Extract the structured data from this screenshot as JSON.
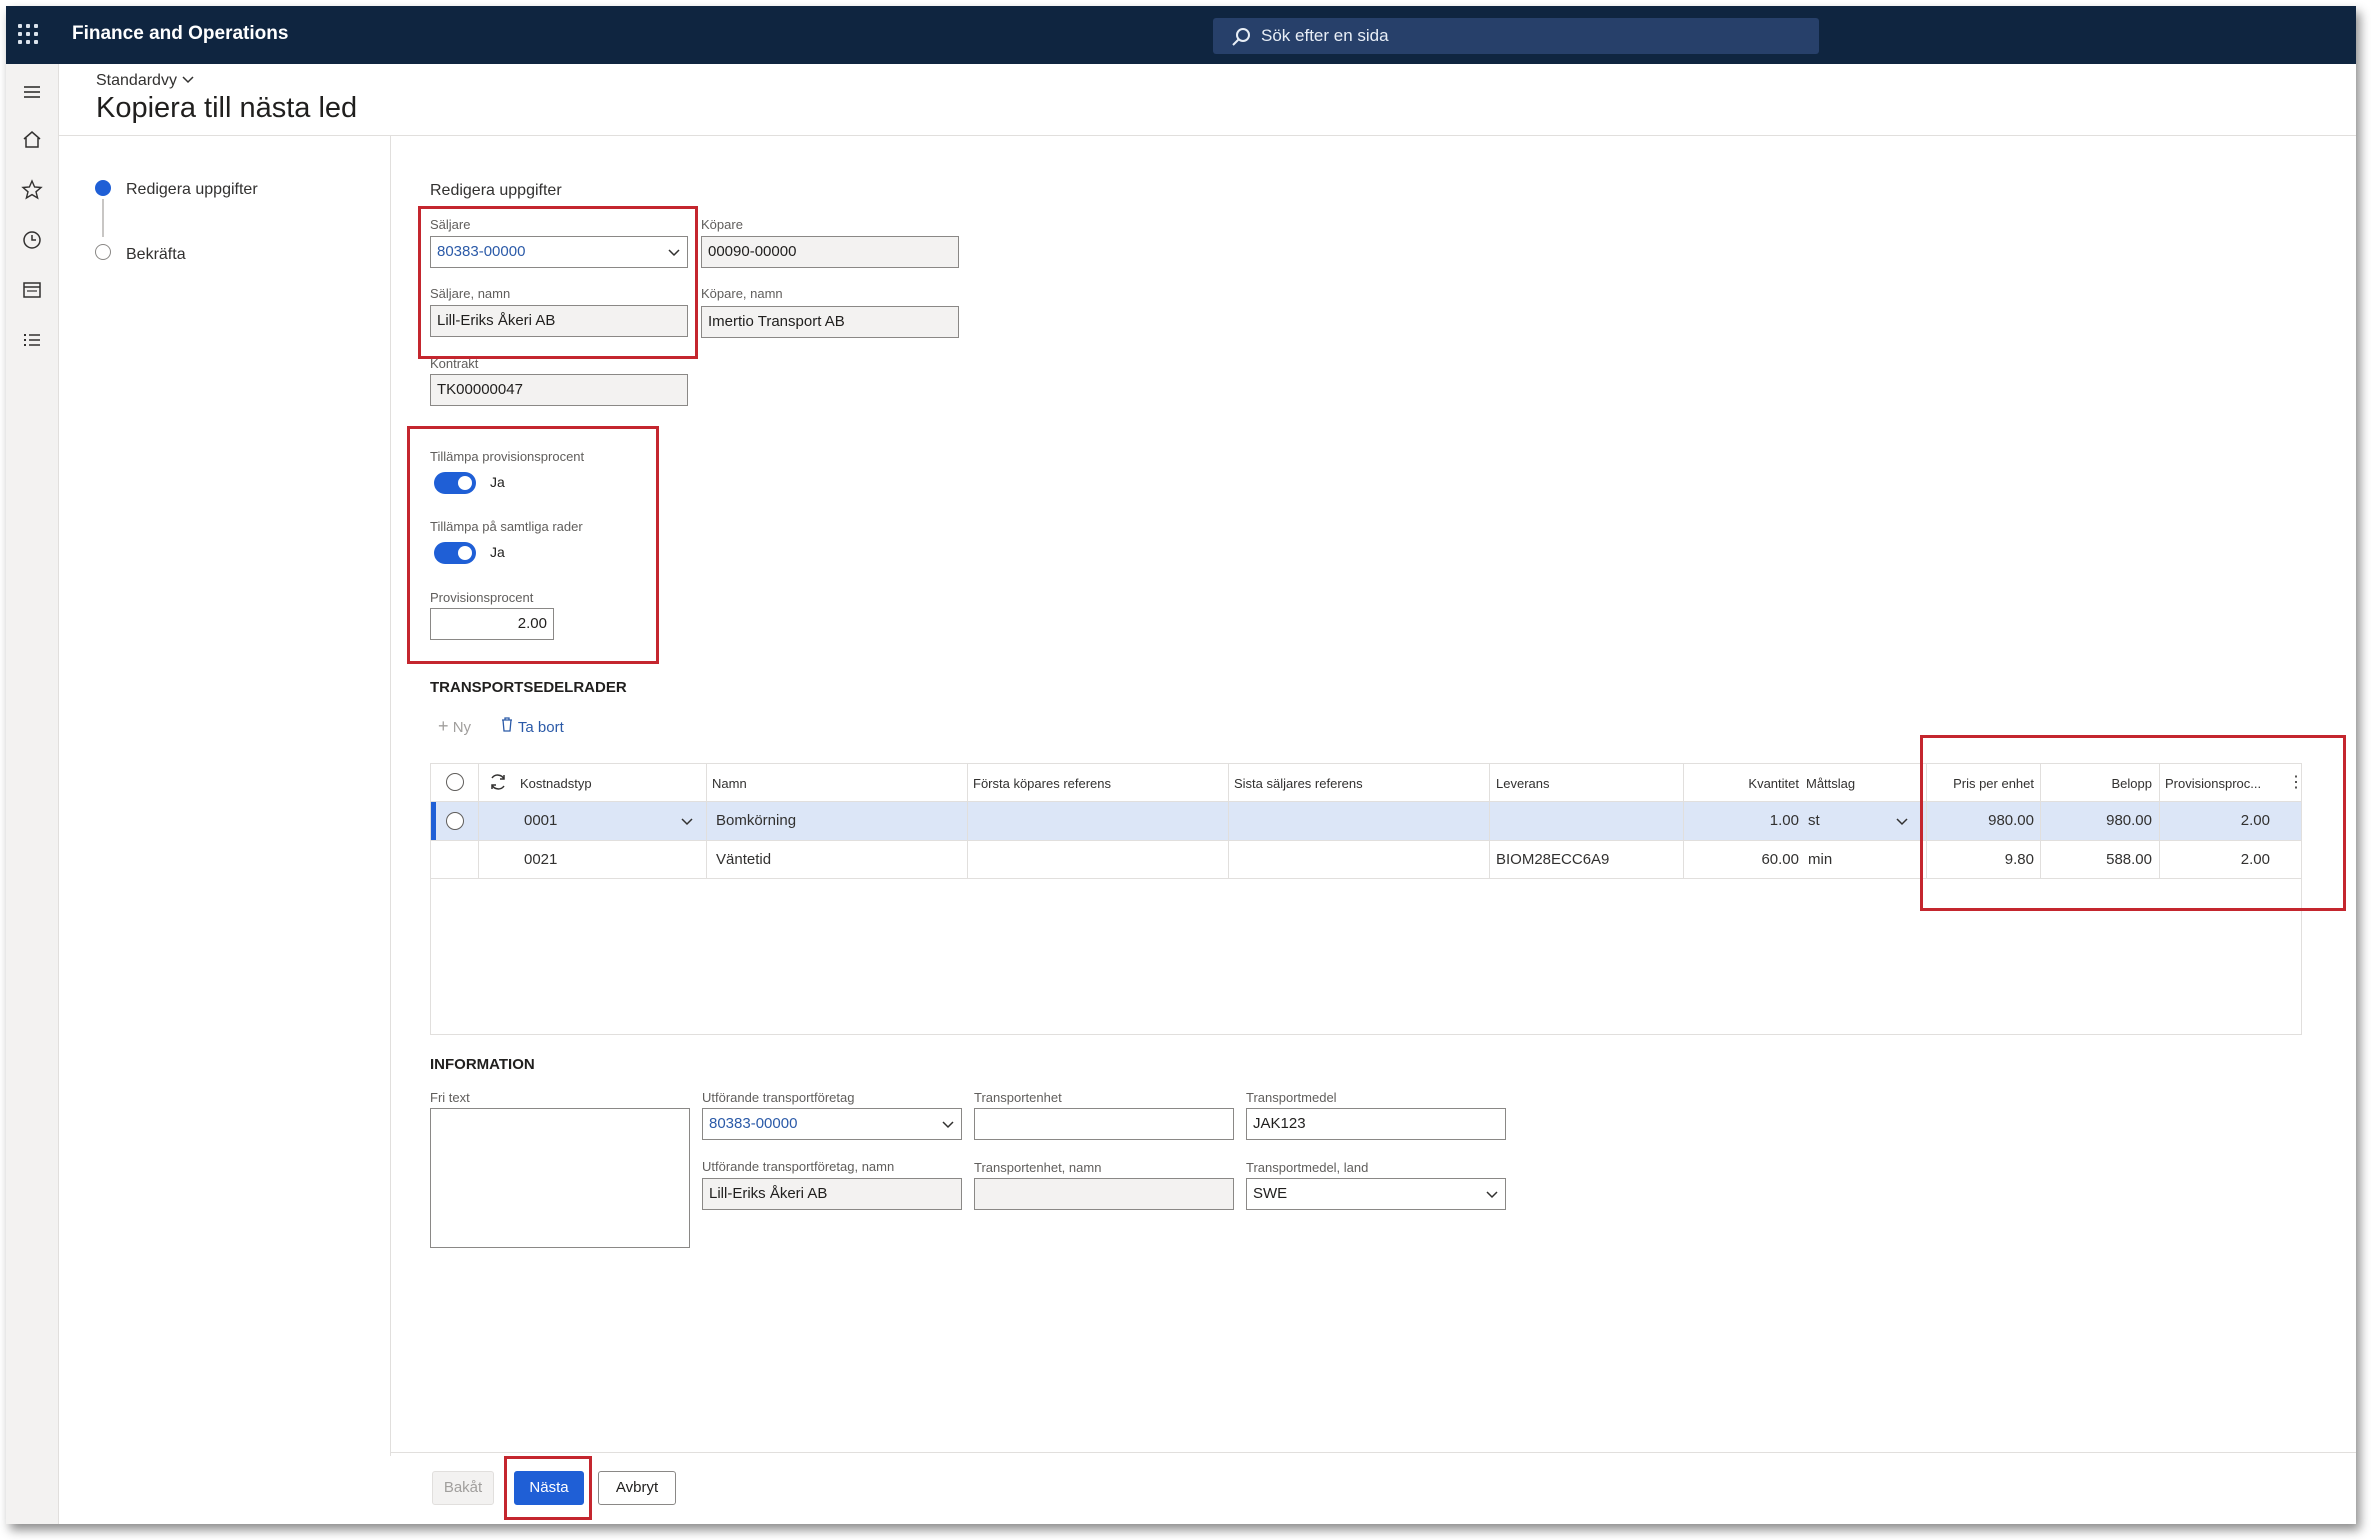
{
  "app": {
    "title": "Finance and Operations"
  },
  "search": {
    "placeholder": "Sök efter en sida"
  },
  "header": {
    "view": "Standardvy",
    "title": "Kopiera till nästa led"
  },
  "steps": [
    {
      "label": "Redigera uppgifter",
      "active": true
    },
    {
      "label": "Bekräfta",
      "active": false
    }
  ],
  "form": {
    "section_title": "Redigera uppgifter",
    "seller_label": "Säljare",
    "seller_value": "80383-00000",
    "seller_name_label": "Säljare, namn",
    "seller_name_value": "Lill-Eriks Åkeri AB",
    "buyer_label": "Köpare",
    "buyer_value": "00090-00000",
    "buyer_name_label": "Köpare, namn",
    "buyer_name_value": "Imertio Transport AB",
    "contract_label": "Kontrakt",
    "contract_value": "TK00000047",
    "apply_commission_label": "Tillämpa provisionsprocent",
    "apply_commission_value": "Ja",
    "apply_all_rows_label": "Tillämpa på samtliga rader",
    "apply_all_rows_value": "Ja",
    "commission_label": "Provisionsprocent",
    "commission_value": "2.00"
  },
  "lines": {
    "title": "TRANSPORTSEDELRADER",
    "new_label": "Ny",
    "delete_label": "Ta bort",
    "columns": [
      "Kostnadstyp",
      "Namn",
      "Första köpares referens",
      "Sista säljares referens",
      "Leverans",
      "Kvantitet",
      "Måttslag",
      "Pris per enhet",
      "Belopp",
      "Provisionsproc..."
    ],
    "rows": [
      {
        "cost_type": "0001",
        "name": "Bomkörning",
        "first_ref": "",
        "last_ref": "",
        "delivery": "",
        "qty": "1.00",
        "unit": "st",
        "price": "980.00",
        "amount": "980.00",
        "commission": "2.00"
      },
      {
        "cost_type": "0021",
        "name": "Väntetid",
        "first_ref": "",
        "last_ref": "",
        "delivery": "BIOM28ECC6A9",
        "qty": "60.00",
        "unit": "min",
        "price": "9.80",
        "amount": "588.00",
        "commission": "2.00"
      }
    ]
  },
  "info": {
    "title": "INFORMATION",
    "free_text_label": "Fri text",
    "carrier_label": "Utförande transportföretag",
    "carrier_value": "80383-00000",
    "carrier_name_label": "Utförande transportföretag, namn",
    "carrier_name_value": "Lill-Eriks Åkeri AB",
    "unit_label": "Transportenhet",
    "unit_value": "",
    "unit_name_label": "Transportenhet, namn",
    "unit_name_value": "",
    "vehicle_label": "Transportmedel",
    "vehicle_value": "JAK123",
    "vehicle_country_label": "Transportmedel, land",
    "vehicle_country_value": "SWE"
  },
  "footer": {
    "back": "Bakåt",
    "next": "Nästa",
    "cancel": "Avbryt"
  },
  "colors": {
    "topbar": "#0f2540",
    "accent": "#1f5fd6",
    "highlight": "#c4262e"
  }
}
